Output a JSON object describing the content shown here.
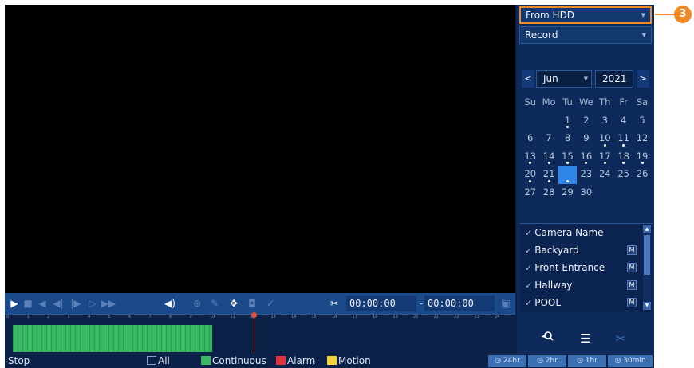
{
  "source_dropdown": {
    "value": "From HDD"
  },
  "type_dropdown": {
    "value": "Record"
  },
  "callout": {
    "label": "3"
  },
  "calendar": {
    "month": "Jun",
    "year": "2021",
    "prev": "<",
    "next": ">",
    "weekdays": [
      "Su",
      "Mo",
      "Tu",
      "We",
      "Th",
      "Fr",
      "Sa"
    ],
    "weeks": [
      [
        "",
        "",
        "1",
        "2",
        "3",
        "4",
        "5"
      ],
      [
        "6",
        "7",
        "8",
        "9",
        "10",
        "11",
        "12"
      ],
      [
        "13",
        "14",
        "15",
        "16",
        "17",
        "18",
        "19"
      ],
      [
        "20",
        "21",
        "22",
        "23",
        "24",
        "25",
        "26"
      ],
      [
        "27",
        "28",
        "29",
        "30",
        "",
        "",
        ""
      ]
    ],
    "selected_day": "22",
    "recorded_days": [
      "1",
      "10",
      "11",
      "13",
      "14",
      "15",
      "16",
      "17",
      "18",
      "19",
      "20",
      "21"
    ]
  },
  "camera_list": {
    "header": "Camera Name",
    "cameras": [
      {
        "name": "Backyard",
        "badge": "M"
      },
      {
        "name": "Front Entrance",
        "badge": "M"
      },
      {
        "name": "Hallway",
        "badge": "M"
      },
      {
        "name": "POOL",
        "badge": "M"
      }
    ]
  },
  "toolbar": {
    "start_time": "00:00:00",
    "end_time": "00:00:00",
    "separator": "-"
  },
  "timeline": {
    "hours": [
      "0",
      "1",
      "2",
      "3",
      "4",
      "5",
      "6",
      "7",
      "8",
      "9",
      "10",
      "11",
      "12",
      "13",
      "14",
      "15",
      "16",
      "17",
      "18",
      "19",
      "20",
      "21",
      "22",
      "23",
      "24"
    ]
  },
  "status": {
    "state": "Stop",
    "legend": [
      {
        "label": "All",
        "color": "#0b2147"
      },
      {
        "label": "Continuous",
        "color": "#3ab964"
      },
      {
        "label": "Alarm",
        "color": "#e0343c"
      },
      {
        "label": "Motion",
        "color": "#f2cf3c"
      }
    ],
    "zoom": [
      "24hr",
      "2hr",
      "1hr",
      "30min"
    ]
  }
}
